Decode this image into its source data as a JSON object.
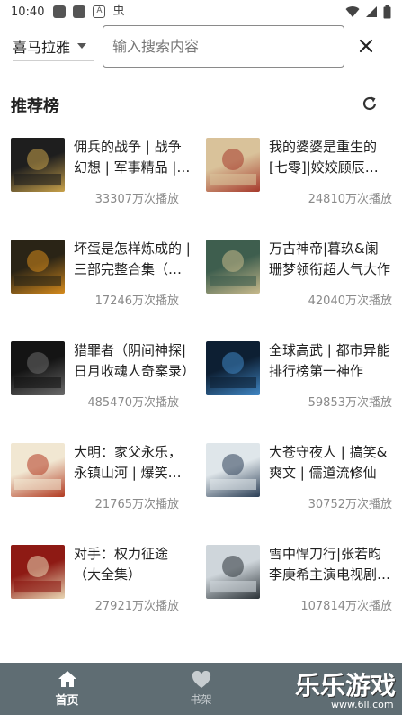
{
  "status_bar": {
    "time": "10:40",
    "notif_icons": [
      "app-icon",
      "app-icon",
      "A",
      "虫"
    ]
  },
  "search": {
    "platform": "喜马拉雅",
    "placeholder": "输入搜索内容"
  },
  "section": {
    "title": "推荐榜"
  },
  "books": [
    {
      "title": "佣兵的战争 | 战争幻想 | 军事精品 | 多人有声剧",
      "plays": "33307万次播放",
      "cover_colors": [
        "#1e1e1e",
        "#c9a24a"
      ],
      "cover_text": "佣兵的战争"
    },
    {
      "title": "我的婆婆是重生的[七零]|姣姣顾辰小说",
      "plays": "24810万次播放",
      "cover_colors": [
        "#d9c29a",
        "#a63a2c"
      ],
      "cover_text": ""
    },
    {
      "title": "坏蛋是怎样炼成的 | 三部完整合集（多人剧）",
      "plays": "17246万次播放",
      "cover_colors": [
        "#2a2416",
        "#d58a1c"
      ],
      "cover_text": "坏蛋"
    },
    {
      "title": "万古神帝|暮玖&阑珊梦领衔超人气大作",
      "plays": "42040万次播放",
      "cover_colors": [
        "#3e5e4e",
        "#c7b98b"
      ],
      "cover_text": "万古神帝"
    },
    {
      "title": "猎罪者（阴间神探|日月收魂人奇案录）",
      "plays": "485470万次播放",
      "cover_colors": [
        "#141414",
        "#6a6a6a"
      ],
      "cover_text": "猎罪者"
    },
    {
      "title": "全球高武 | 都市异能排行榜第一神作",
      "plays": "59853万次播放",
      "cover_colors": [
        "#0d1f33",
        "#3f86c4"
      ],
      "cover_text": "全球高武"
    },
    {
      "title": "大明：家父永乐，永镇山河 | 爆笑历史",
      "plays": "21765万次播放",
      "cover_colors": [
        "#f1e7d2",
        "#b23b22"
      ],
      "cover_text": "家父永乐"
    },
    {
      "title": "大苍守夜人 | 搞笑&爽文 | 儒道流修仙",
      "plays": "30752万次播放",
      "cover_colors": [
        "#dfe6ea",
        "#2d4057"
      ],
      "cover_text": "大苍"
    },
    {
      "title": "对手：权力征途（大全集）",
      "plays": "27921万次播放",
      "cover_colors": [
        "#8e1a14",
        "#e9d7b4"
      ],
      "cover_text": "对手"
    },
    {
      "title": "雪中悍刀行|张若昀李庚希主演电视剧原著",
      "plays": "107814万次播放",
      "cover_colors": [
        "#cfd6db",
        "#2c3338"
      ],
      "cover_text": "雪中悍刀行"
    }
  ],
  "nav": {
    "home": "首页",
    "shelf": "书架"
  },
  "watermark": {
    "main": "乐乐游戏",
    "sub": "www.6ll.com"
  },
  "colors": {
    "nav_bg": "#5f6d73",
    "text_muted": "#8a8a8a"
  }
}
